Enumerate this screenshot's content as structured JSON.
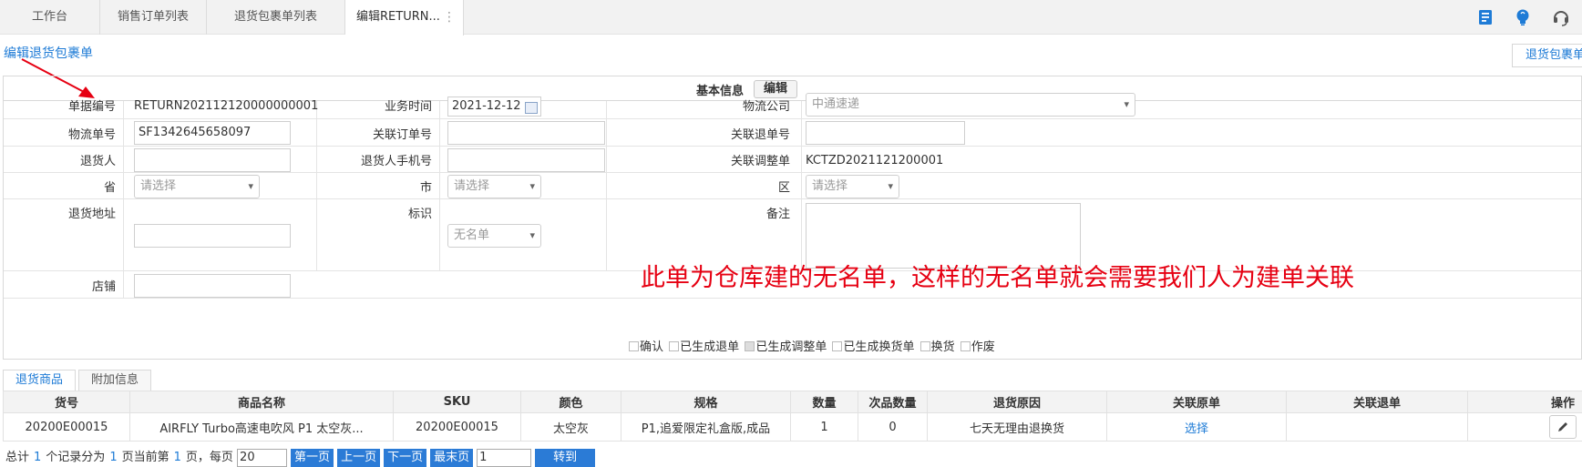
{
  "tabs": [
    {
      "label": "工作台"
    },
    {
      "label": "销售订单列表"
    },
    {
      "label": "退货包裹单列表"
    },
    {
      "label": "编辑RETURN..."
    }
  ],
  "page_link": "编辑退货包裹单",
  "right_button": "退货包裹单",
  "section": {
    "title": "基本信息",
    "edit_label": "编辑"
  },
  "form": {
    "doc_no_label": "单据编号",
    "doc_no_value": "RETURN202112120000000001",
    "biz_time_label": "业务时间",
    "biz_time_value": "2021-12-12",
    "logistics_company_label": "物流公司",
    "logistics_company_value": "中通速递",
    "tracking_no_label": "物流单号",
    "tracking_no_value": "SF1342645658097",
    "related_order_label": "关联订单号",
    "related_return_label": "关联退单号",
    "returner_label": "退货人",
    "returner_phone_label": "退货人手机号",
    "related_adjust_label": "关联调整单",
    "related_adjust_value": "KCTZD2021121200001",
    "province_label": "省",
    "city_label": "市",
    "district_label": "区",
    "select_placeholder": "请选择",
    "address_label": "退货地址",
    "tag_label": "标识",
    "tag_value": "无名单",
    "remark_label": "备注",
    "shop_label": "店铺"
  },
  "checkboxes": [
    {
      "label": "确认",
      "checked": false
    },
    {
      "label": "已生成退单",
      "checked": false
    },
    {
      "label": "已生成调整单",
      "checked": true
    },
    {
      "label": "已生成换货单",
      "checked": false
    },
    {
      "label": "换货",
      "checked": false
    },
    {
      "label": "作废",
      "checked": false
    }
  ],
  "annotation": "此单为仓库建的无名单，这样的无名单就会需要我们人为建单关联",
  "sub_tabs": [
    {
      "label": "退货商品"
    },
    {
      "label": "附加信息"
    }
  ],
  "table": {
    "columns": [
      "货号",
      "商品名称",
      "SKU",
      "颜色",
      "规格",
      "数量",
      "次品数量",
      "退货原因",
      "关联原单",
      "关联退单",
      "操作"
    ],
    "rows": [
      {
        "item_no": "20200E00015",
        "name": "AIRFLY Turbo高速电吹风 P1 太空灰...",
        "sku": "20200E00015",
        "color": "太空灰",
        "spec": "P1,追爱限定礼盒版,成品",
        "qty": "1",
        "defect_qty": "0",
        "reason": "七天无理由退换货",
        "related_order": "选择",
        "related_return": ""
      }
    ]
  },
  "pager": {
    "text_total": "总计",
    "total": "1",
    "text_records": "个记录分为",
    "pages": "1",
    "text_current": "页当前第",
    "current": "1",
    "text_per_page": "页，每页",
    "per_page": "20",
    "first": "第一页",
    "prev": "上一页",
    "next": "下一页",
    "last": "最末页",
    "goto_value": "1",
    "goto": "转到"
  },
  "colors": {
    "accent": "#1e7bd6",
    "annotation": "#e60012",
    "pager_button": "#2b7bd6"
  },
  "header_icons": [
    "book-icon",
    "lightbulb-icon",
    "headset-icon"
  ]
}
